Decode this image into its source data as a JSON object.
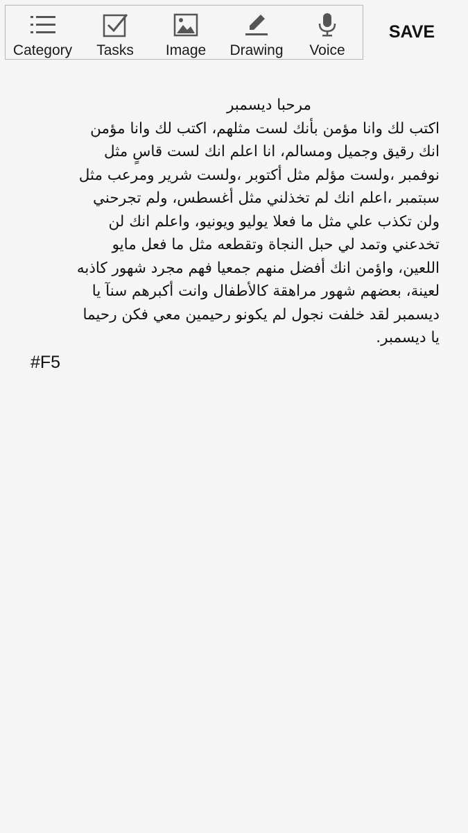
{
  "toolbar": {
    "items": [
      {
        "label": "Category",
        "icon": "list-icon"
      },
      {
        "label": "Tasks",
        "icon": "checkbox-icon"
      },
      {
        "label": "Image",
        "icon": "image-icon"
      },
      {
        "label": "Drawing",
        "icon": "pencil-icon"
      },
      {
        "label": "Voice",
        "icon": "microphone-icon"
      }
    ],
    "save_label": "SAVE"
  },
  "note": {
    "lines": [
      "مرحبا ديسمبر",
      "اكتب لك وانا مؤمن بأنك لست مثلهم، اكتب لك وانا مؤمن",
      "انك رقيق وجميل ومسالم، انا اعلم انك لست قاسٍ مثل",
      "نوفمبر ،ولست مؤلم مثل أكتوبر ،ولست شرير ومرعب مثل",
      "سبتمبر ،اعلم انك لم تخذلني مثل أغسطس،  ولم تجرحني",
      "ولن تكذب علي مثل ما فعلا يوليو ويونيو، واعلم انك لن",
      "تخدعني وتمد لي حبل النجاة وتقطعه مثل ما فعل مايو",
      "اللعين، واؤمن انك أفضل منهم جمعيا فهم مجرد شهور كاذبه",
      "لعينة، بعضهم شهور مراهقة كالأطفال وانت أكبرهم سنآ يا",
      "ديسمبر لقد خلفت نجول لم يكونو رحيمين معي فكن رحيما",
      "يا ديسمبر."
    ],
    "hashtag": "#F5"
  },
  "colors": {
    "background": "#f5f5f5",
    "icon": "#555555",
    "text": "#111111",
    "border": "#b5b5b5"
  }
}
